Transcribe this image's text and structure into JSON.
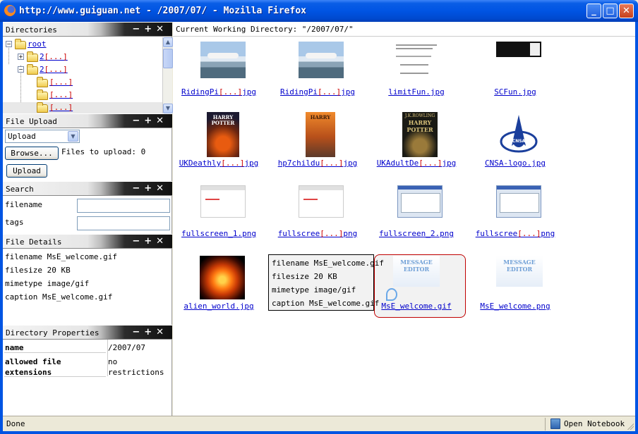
{
  "window": {
    "title": "http://www.guiguan.net - /2007/07/ - Mozilla Firefox",
    "minimize": "_",
    "maximize": "□",
    "close": "✕"
  },
  "panels": {
    "directories": {
      "title": "Directories"
    },
    "upload": {
      "title": "File Upload"
    },
    "search": {
      "title": "Search"
    },
    "details": {
      "title": "File Details"
    },
    "props": {
      "title": "Directory Properties"
    },
    "controls": "−+✕"
  },
  "tree": {
    "root": "root",
    "items": [
      {
        "pre": "2",
        "red": "[...]"
      },
      {
        "pre": "2",
        "red": "[...]"
      },
      {
        "pre": "",
        "red": "[...]"
      },
      {
        "pre": "",
        "red": "[...]"
      },
      {
        "pre": "",
        "red": "[...]"
      }
    ],
    "plus": "+",
    "minus": "−"
  },
  "scroll": {
    "up": "▲",
    "down": "▼"
  },
  "upload": {
    "select_value": "Upload",
    "select_arrow": "▼",
    "browse_label": "Browse...",
    "files_to_upload": "Files to upload: 0",
    "upload_label": "Upload"
  },
  "search": {
    "filename_label": "filename",
    "tags_label": "tags",
    "filename_value": "",
    "tags_value": ""
  },
  "details": {
    "filename": "filename MsE_welcome.gif",
    "filesize": "filesize 20 KB",
    "mimetype": "mimetype image/gif",
    "caption": "caption  MsE_welcome.gif"
  },
  "props": {
    "name_label": "name",
    "name_value": "/2007/07",
    "ext_label_1": "allowed file",
    "ext_label_2": "extensions",
    "ext_value_1": "no",
    "ext_value_2": "restrictions"
  },
  "cwd": "Current Working Directory: \"/2007/07/\"",
  "files": [
    {
      "pre": "RidingPi",
      "red": "[...]",
      "post": "jpg"
    },
    {
      "pre": "RidingPi",
      "red": "[...]",
      "post": "jpg"
    },
    {
      "pre": "limitFun.jpg",
      "red": "",
      "post": ""
    },
    {
      "pre": "SCFun.jpg",
      "red": "",
      "post": ""
    },
    {
      "pre": "UKDeathly",
      "red": "[...]",
      "post": "jpg"
    },
    {
      "pre": "hp7childu",
      "red": "[...]",
      "post": "jpg"
    },
    {
      "pre": "UKAdultDe",
      "red": "[...]",
      "post": "jpg"
    },
    {
      "pre": "CNSA-logo.jpg",
      "red": "",
      "post": ""
    },
    {
      "pre": "fullscreen_1.png",
      "red": "",
      "post": ""
    },
    {
      "pre": "fullscree",
      "red": "[...]",
      "post": "png"
    },
    {
      "pre": "fullscreen_2.png",
      "red": "",
      "post": ""
    },
    {
      "pre": "fullscree",
      "red": "[...]",
      "post": "png"
    },
    {
      "pre": "alien_world.jpg",
      "red": "",
      "post": ""
    },
    {
      "pre": "",
      "red": "",
      "post": ""
    },
    {
      "pre": "MsE_welcome.gif",
      "red": "",
      "post": ""
    },
    {
      "pre": "MsE_welcome.png",
      "red": "",
      "post": ""
    }
  ],
  "thumb_text": {
    "harry": "HARRY",
    "potter": "POTTER",
    "rowling": "J.K.ROWLING",
    "cnsa": "CNSA",
    "mse_title": "MESSAGE",
    "mse_sub": "EDITOR"
  },
  "popup": {
    "filename": "filename MsE_welcome.gif",
    "filesize": "filesize 20 KB",
    "mimetype": "mimetype image/gif",
    "caption": "caption  MsE_welcome.gif"
  },
  "status": {
    "text": "Done",
    "notebook": "Open Notebook"
  }
}
